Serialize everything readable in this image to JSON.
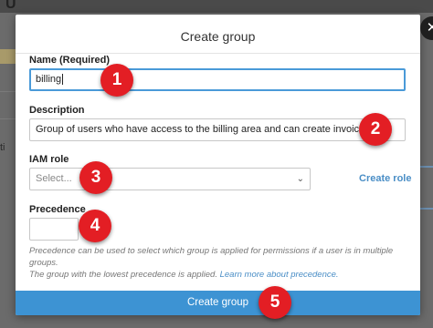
{
  "background": {
    "glyph": "U",
    "tail_text": "ti"
  },
  "dialog": {
    "title": "Create group",
    "close_icon": "close-icon",
    "name_label": "Name (Required)",
    "name_value": "billing",
    "description_label": "Description",
    "description_value": "Group of users who have access to the billing area and can create invoices",
    "iam_role_label": "IAM role",
    "iam_role_placeholder": "Select...",
    "create_role_link": "Create role",
    "precedence_label": "Precedence",
    "precedence_value": "",
    "precedence_help_1": "Precedence can be used to select which group is applied for permissions if a user is in multiple groups.",
    "precedence_help_2": "The group with the lowest precedence is applied. ",
    "precedence_help_link": "Learn more about precedence.",
    "submit_label": "Create group"
  },
  "markers": [
    "1",
    "2",
    "3",
    "4",
    "5"
  ],
  "colors": {
    "accent": "#3d93d3",
    "link": "#4a8ec6",
    "marker": "#e31e24",
    "focus_border": "#4a9ad8"
  }
}
